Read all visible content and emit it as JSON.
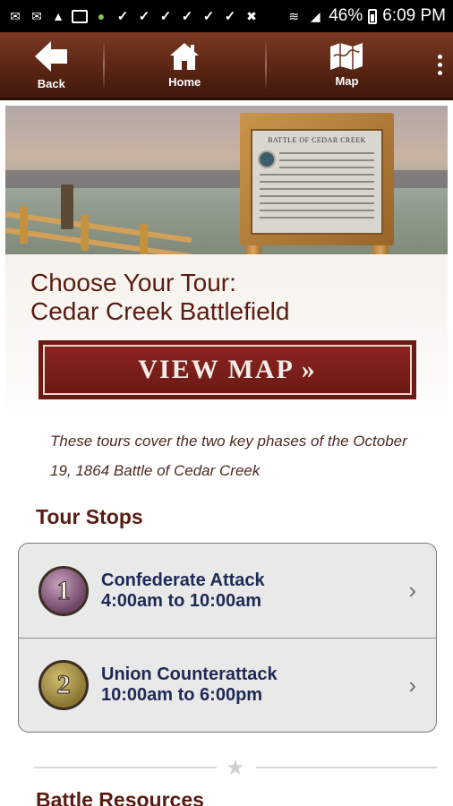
{
  "status_bar": {
    "battery": "46%",
    "time": "6:09 PM"
  },
  "toolbar": {
    "back_label": "Back",
    "home_label": "Home",
    "map_label": "Map"
  },
  "hero": {
    "sign_title": "BATTLE OF CEDAR CREEK"
  },
  "page": {
    "title_line1": "Choose Your Tour:",
    "title_line2": "Cedar Creek Battlefield"
  },
  "view_map_button": {
    "label": "VIEW MAP »"
  },
  "intro": {
    "text": "These tours cover the two key phases of the October 19, 1864 Battle of Cedar Creek"
  },
  "tour_stops": {
    "heading": "Tour Stops",
    "items": [
      {
        "number": "1",
        "name": "Confederate Attack",
        "time": "4:00am to 10:00am"
      },
      {
        "number": "2",
        "name": "Union Counterattack",
        "time": "10:00am to 6:00pm"
      }
    ]
  },
  "battle_resources": {
    "heading": "Battle Resources"
  },
  "colors": {
    "toolbar": "#5a2614",
    "accent_maroon": "#6b1a15",
    "heading": "#5a1c10",
    "tour_text": "#1d2a55"
  }
}
